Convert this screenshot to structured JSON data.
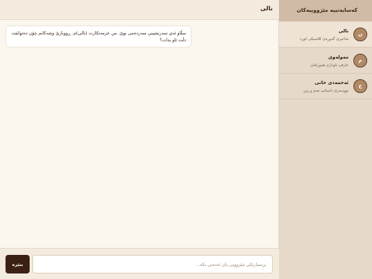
{
  "chat": {
    "title": "نالی",
    "message": "سڵاو ئەی سەرنشینی سەردەمی نوێ. من خزمەتکارت (نالی)م. ڕووبارێ وشەکانم چۆن دەتوانێت دڵت ئاو بدات؟"
  },
  "composer": {
    "placeholder": "پرسیارێکی مێژوویی یان ئەدەبی بکە...",
    "send_label": "بنێرە"
  },
  "sidebar": {
    "title": "کەسایەتییە مێژووییەکان",
    "items": [
      {
        "name": "نالی",
        "description": "شاعیری گەورەی کلاسیکی کورد",
        "initial": "ن",
        "active": true
      },
      {
        "name": "مەولەوی",
        "description": "عارفی ناوداری هەورامان",
        "initial": "م",
        "active": false
      },
      {
        "name": "ئەحمەدی خانی",
        "description": "نووسەری داستانی مەم و زین",
        "initial": "خ",
        "active": false
      }
    ]
  }
}
